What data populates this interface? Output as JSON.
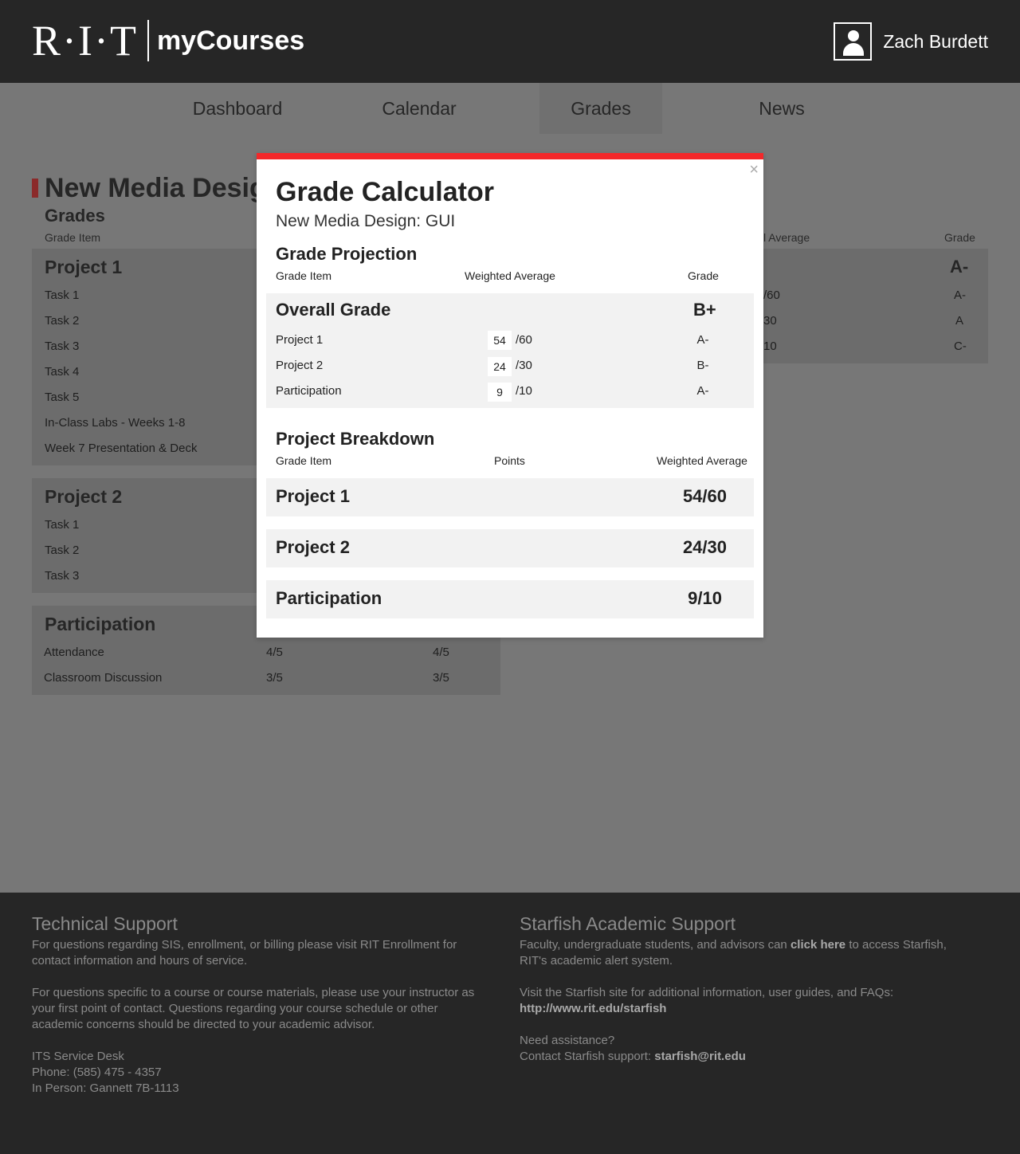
{
  "header": {
    "logo_text": "R·I·T",
    "app_name": "myCourses",
    "user_name": "Zach Burdett"
  },
  "nav": {
    "items": [
      "Dashboard",
      "Calendar",
      "Grades",
      "News"
    ],
    "active": "Grades"
  },
  "background": {
    "course_title": "New Media Desig",
    "grades_heading": "Grades",
    "col_grade_item": "Grade Item",
    "col_weighted_avg": "Weighted Average",
    "col_weighted_avg_partial": "l Average",
    "col_grade": "Grade",
    "project1": {
      "title": "Project 1",
      "rows": [
        "Task 1",
        "Task 2",
        "Task 3",
        "Task 4",
        "Task 5",
        "In-Class Labs - Weeks 1-8",
        "Week 7 Presentation & Deck"
      ]
    },
    "project2": {
      "title": "Project 2",
      "rows": [
        "Task 1",
        "Task 2",
        "Task 3"
      ]
    },
    "participation": {
      "title": "Participation",
      "rows": [
        {
          "name": "Attendance",
          "points": "4/5",
          "weighted": "4/5"
        },
        {
          "name": "Classroom Discussion",
          "points": "3/5",
          "weighted": "3/5"
        }
      ]
    },
    "right_summary": {
      "grade_top": "A-",
      "rows": [
        {
          "weighted": "/60",
          "grade": "A-"
        },
        {
          "weighted": "30",
          "grade": "A"
        },
        {
          "weighted": "10",
          "grade": "C-"
        }
      ]
    }
  },
  "modal": {
    "close_label": "×",
    "title": "Grade Calculator",
    "subtitle": "New Media Design: GUI",
    "projection": {
      "heading": "Grade Projection",
      "col_item": "Grade Item",
      "col_weighted": "Weighted Average",
      "col_grade": "Grade",
      "overall_label": "Overall Grade",
      "overall_grade": "B+",
      "rows": [
        {
          "name": "Project 1",
          "value": "54",
          "max": "/60",
          "grade": "A-"
        },
        {
          "name": "Project 2",
          "value": "24",
          "max": "/30",
          "grade": "B-"
        },
        {
          "name": "Participation",
          "value": "9",
          "max": "/10",
          "grade": "A-"
        }
      ]
    },
    "breakdown": {
      "heading": "Project Breakdown",
      "col_item": "Grade Item",
      "col_points": "Points",
      "col_weighted": "Weighted Average",
      "rows": [
        {
          "name": "Project 1",
          "score": "54/60"
        },
        {
          "name": "Project 2",
          "score": "24/30"
        },
        {
          "name": "Participation",
          "score": "9/10"
        }
      ]
    }
  },
  "footer": {
    "tech": {
      "heading": "Technical Support",
      "p1": "For questions regarding SIS, enrollment, or billing please visit RIT Enrollment for contact information and hours of service.",
      "p2": "For questions specific to a course or course materials, please use your instructor as your first point of contact. Questions regarding your course schedule or other academic concerns should be directed to your academic advisor.",
      "desk": "ITS Service Desk",
      "phone": "Phone: (585) 475 - 4357",
      "in_person": "In Person: Gannett 7B-1113"
    },
    "starfish": {
      "heading": "Starfish Academic Support",
      "p1_pre": "Faculty, undergraduate students, and advisors can ",
      "p1_link": "click here",
      "p1_post": " to access Starfish, RIT's academic alert system.",
      "p2": "Visit the Starfish site for additional information, user guides, and FAQs:",
      "url": "http://www.rit.edu/starfish",
      "assist": "Need assistance?",
      "contact_pre": "Contact Starfish support: ",
      "email": "starfish@rit.edu"
    }
  }
}
